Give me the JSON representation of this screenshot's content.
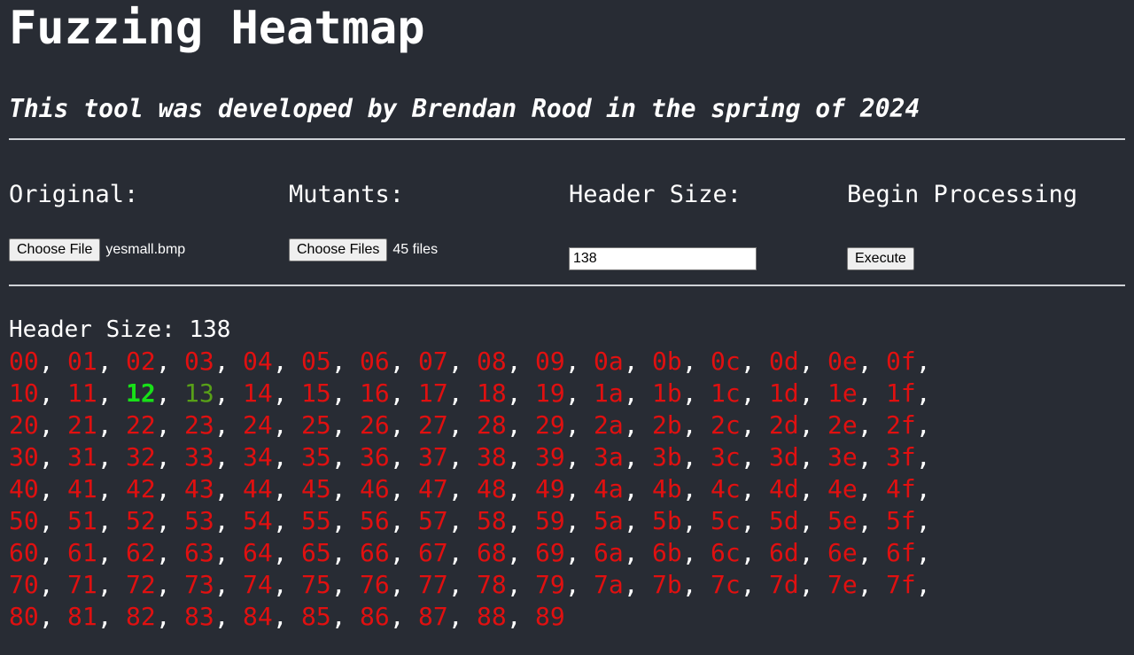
{
  "header": {
    "title": "Fuzzing Heatmap",
    "subtitle": "This tool was developed by Brendan Rood in the spring of 2024"
  },
  "controls": {
    "original": {
      "label": "Original:",
      "button_label": "Choose File",
      "status": "yesmall.bmp"
    },
    "mutants": {
      "label": "Mutants:",
      "button_label": "Choose Files",
      "status": "45 files"
    },
    "header_size": {
      "label": "Header Size:",
      "value": "138"
    },
    "begin": {
      "label": "Begin Processing",
      "button_label": "Execute"
    }
  },
  "results": {
    "header_label": "Header Size: 138",
    "separator": ",",
    "colors": {
      "default": "#e01010",
      "highlight_bright": "#18e018",
      "highlight_dark": "#58a018"
    },
    "rows": [
      [
        {
          "v": "00"
        },
        {
          "v": "01"
        },
        {
          "v": "02"
        },
        {
          "v": "03"
        },
        {
          "v": "04"
        },
        {
          "v": "05"
        },
        {
          "v": "06"
        },
        {
          "v": "07"
        },
        {
          "v": "08"
        },
        {
          "v": "09"
        },
        {
          "v": "0a"
        },
        {
          "v": "0b"
        },
        {
          "v": "0c"
        },
        {
          "v": "0d"
        },
        {
          "v": "0e"
        },
        {
          "v": "0f"
        }
      ],
      [
        {
          "v": "10"
        },
        {
          "v": "11"
        },
        {
          "v": "12",
          "c": "green-bold"
        },
        {
          "v": "13",
          "c": "green-dark"
        },
        {
          "v": "14"
        },
        {
          "v": "15"
        },
        {
          "v": "16"
        },
        {
          "v": "17"
        },
        {
          "v": "18"
        },
        {
          "v": "19"
        },
        {
          "v": "1a"
        },
        {
          "v": "1b"
        },
        {
          "v": "1c"
        },
        {
          "v": "1d"
        },
        {
          "v": "1e"
        },
        {
          "v": "1f"
        }
      ],
      [
        {
          "v": "20"
        },
        {
          "v": "21"
        },
        {
          "v": "22"
        },
        {
          "v": "23"
        },
        {
          "v": "24"
        },
        {
          "v": "25"
        },
        {
          "v": "26"
        },
        {
          "v": "27"
        },
        {
          "v": "28"
        },
        {
          "v": "29"
        },
        {
          "v": "2a"
        },
        {
          "v": "2b"
        },
        {
          "v": "2c"
        },
        {
          "v": "2d"
        },
        {
          "v": "2e"
        },
        {
          "v": "2f"
        }
      ],
      [
        {
          "v": "30"
        },
        {
          "v": "31"
        },
        {
          "v": "32"
        },
        {
          "v": "33"
        },
        {
          "v": "34"
        },
        {
          "v": "35"
        },
        {
          "v": "36"
        },
        {
          "v": "37"
        },
        {
          "v": "38"
        },
        {
          "v": "39"
        },
        {
          "v": "3a"
        },
        {
          "v": "3b"
        },
        {
          "v": "3c"
        },
        {
          "v": "3d"
        },
        {
          "v": "3e"
        },
        {
          "v": "3f"
        }
      ],
      [
        {
          "v": "40"
        },
        {
          "v": "41"
        },
        {
          "v": "42"
        },
        {
          "v": "43"
        },
        {
          "v": "44"
        },
        {
          "v": "45"
        },
        {
          "v": "46"
        },
        {
          "v": "47"
        },
        {
          "v": "48"
        },
        {
          "v": "49"
        },
        {
          "v": "4a"
        },
        {
          "v": "4b"
        },
        {
          "v": "4c"
        },
        {
          "v": "4d"
        },
        {
          "v": "4e"
        },
        {
          "v": "4f"
        }
      ],
      [
        {
          "v": "50"
        },
        {
          "v": "51"
        },
        {
          "v": "52"
        },
        {
          "v": "53"
        },
        {
          "v": "54"
        },
        {
          "v": "55"
        },
        {
          "v": "56"
        },
        {
          "v": "57"
        },
        {
          "v": "58"
        },
        {
          "v": "59"
        },
        {
          "v": "5a"
        },
        {
          "v": "5b"
        },
        {
          "v": "5c"
        },
        {
          "v": "5d"
        },
        {
          "v": "5e"
        },
        {
          "v": "5f"
        }
      ],
      [
        {
          "v": "60"
        },
        {
          "v": "61"
        },
        {
          "v": "62"
        },
        {
          "v": "63"
        },
        {
          "v": "64"
        },
        {
          "v": "65"
        },
        {
          "v": "66"
        },
        {
          "v": "67"
        },
        {
          "v": "68"
        },
        {
          "v": "69"
        },
        {
          "v": "6a"
        },
        {
          "v": "6b"
        },
        {
          "v": "6c"
        },
        {
          "v": "6d"
        },
        {
          "v": "6e"
        },
        {
          "v": "6f"
        }
      ],
      [
        {
          "v": "70"
        },
        {
          "v": "71"
        },
        {
          "v": "72"
        },
        {
          "v": "73"
        },
        {
          "v": "74"
        },
        {
          "v": "75"
        },
        {
          "v": "76"
        },
        {
          "v": "77"
        },
        {
          "v": "78"
        },
        {
          "v": "79"
        },
        {
          "v": "7a"
        },
        {
          "v": "7b"
        },
        {
          "v": "7c"
        },
        {
          "v": "7d"
        },
        {
          "v": "7e"
        },
        {
          "v": "7f"
        }
      ],
      [
        {
          "v": "80"
        },
        {
          "v": "81"
        },
        {
          "v": "82"
        },
        {
          "v": "83"
        },
        {
          "v": "84"
        },
        {
          "v": "85"
        },
        {
          "v": "86"
        },
        {
          "v": "87"
        },
        {
          "v": "88"
        },
        {
          "v": "89"
        }
      ]
    ]
  }
}
